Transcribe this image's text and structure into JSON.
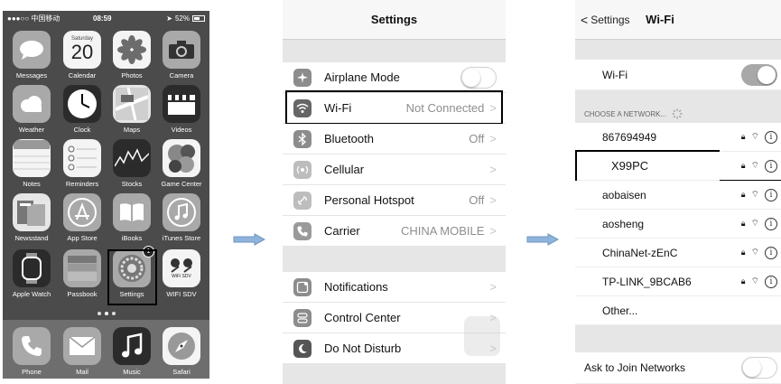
{
  "home": {
    "status": {
      "carrier": "●●●○○ 中国移动",
      "time": "08:59",
      "battery": "52%"
    },
    "apps": [
      {
        "name": "messages",
        "label": "Messages"
      },
      {
        "name": "calendar",
        "label": "Calendar",
        "weekday": "Saturday",
        "day": "20"
      },
      {
        "name": "photos",
        "label": "Photos"
      },
      {
        "name": "camera",
        "label": "Camera"
      },
      {
        "name": "weather",
        "label": "Weather"
      },
      {
        "name": "clock",
        "label": "Clock"
      },
      {
        "name": "maps",
        "label": "Maps"
      },
      {
        "name": "videos",
        "label": "Videos"
      },
      {
        "name": "notes",
        "label": "Notes"
      },
      {
        "name": "reminders",
        "label": "Reminders"
      },
      {
        "name": "stocks",
        "label": "Stocks"
      },
      {
        "name": "game-center",
        "label": "Game Center"
      },
      {
        "name": "newsstand",
        "label": "Newsstand"
      },
      {
        "name": "app-store",
        "label": "App Store"
      },
      {
        "name": "ibooks",
        "label": "iBooks"
      },
      {
        "name": "itunes-store",
        "label": "iTunes Store"
      },
      {
        "name": "apple-watch",
        "label": "Apple Watch"
      },
      {
        "name": "passbook",
        "label": "Passbook"
      },
      {
        "name": "settings",
        "label": "Settings",
        "badge": "1"
      },
      {
        "name": "wifi-sdv",
        "label": "WIFI SDV",
        "icon_text": "WiFi SDV"
      }
    ],
    "dock": [
      {
        "name": "phone",
        "label": "Phone"
      },
      {
        "name": "mail",
        "label": "Mail"
      },
      {
        "name": "music",
        "label": "Music"
      },
      {
        "name": "safari",
        "label": "Safari"
      }
    ]
  },
  "settings": {
    "title": "Settings",
    "rows": [
      {
        "label": "Airplane Mode",
        "value": ""
      },
      {
        "label": "Wi-Fi",
        "value": "Not Connected"
      },
      {
        "label": "Bluetooth",
        "value": "Off"
      },
      {
        "label": "Cellular",
        "value": ""
      },
      {
        "label": "Personal Hotspot",
        "value": "Off"
      },
      {
        "label": "Carrier",
        "value": "CHINA MOBILE"
      },
      {
        "label": "Notifications",
        "value": ""
      },
      {
        "label": "Control Center",
        "value": ""
      },
      {
        "label": "Do Not Disturb",
        "value": ""
      }
    ]
  },
  "wifi": {
    "back_label": "Settings",
    "title": "Wi-Fi",
    "wifi_label": "Wi-Fi",
    "section_header": "CHOOSE A NETWORK...",
    "networks": [
      {
        "name": "867694949"
      },
      {
        "name": "X99PC"
      },
      {
        "name": "aobaisen"
      },
      {
        "name": "aosheng"
      },
      {
        "name": "ChinaNet-zEnC"
      },
      {
        "name": "TP-LINK_9BCAB6"
      }
    ],
    "other_label": "Other...",
    "ask_label": "Ask to Join Networks"
  },
  "colors": {
    "arrow": "#8fb4dc",
    "highlight": "#000000"
  }
}
